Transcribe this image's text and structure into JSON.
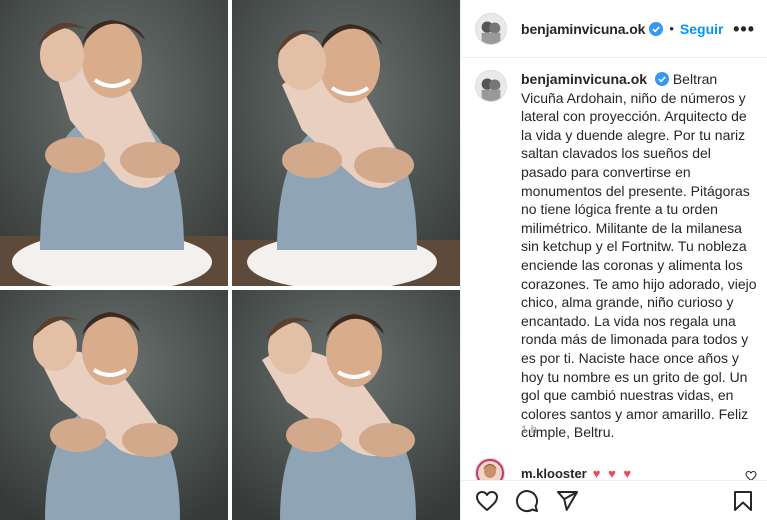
{
  "post": {
    "username": "benjaminvicuna.ok",
    "follow_label": "Seguir",
    "separator": "•",
    "more_label": "•••",
    "caption": "Beltran Vicuña Ardohain, niño de números y lateral con proyección. Arquitecto de la vida y duende alegre. Por tu nariz saltan clavados los sueños del pasado para convertirse en monumentos del presente. Pitágoras no tiene lógica frente a tu orden milimétrico. Militante de la milanesa sin ketchup y el Fortnitw. Tu nobleza enciende las coronas y alimenta los corazones. Te amo hijo adorado, viejo chico, alma grande, niño curioso y encantado. La vida nos regala una ronda más de limonada para todos y es por ti. Naciste hace once años y hoy tu nombre es un grito de gol. Un gol que cambió nuestras vidas, en colores santos y amor amarillo. Feliz cumple, Beltru.",
    "time": "1 h"
  },
  "comment": {
    "username": "m.klooster",
    "text": "♥ ♥ ♥"
  },
  "icons": {
    "like": "heart-icon",
    "comment": "comment-icon",
    "share": "share-icon",
    "save": "bookmark-icon",
    "verified": "verified-badge-icon"
  },
  "colors": {
    "accent": "#0095f6",
    "verified": "#3897f0",
    "heart": "#ed4956",
    "backdrop": "#4f5553",
    "shirt": "#8fa4b5"
  }
}
